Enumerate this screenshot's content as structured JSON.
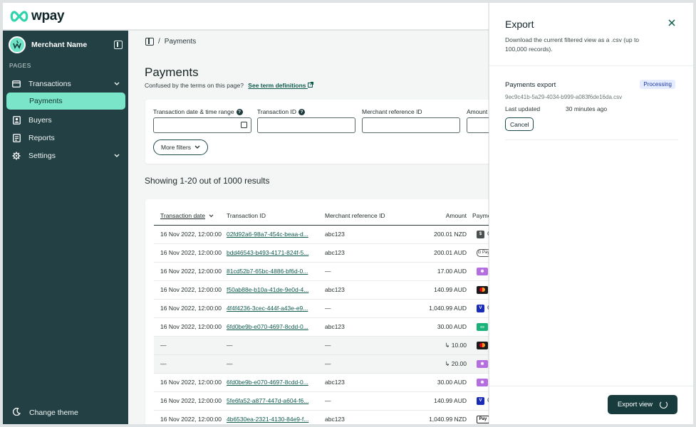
{
  "brand": {
    "name": "wpay"
  },
  "sidebar": {
    "merchant_name": "Merchant Name",
    "section_label": "PAGES",
    "items": [
      {
        "label": "Transactions",
        "icon": "card-icon",
        "has_chevron": true
      },
      {
        "label": "Payments",
        "active": true
      },
      {
        "label": "Buyers",
        "icon": "user-icon"
      },
      {
        "label": "Reports",
        "icon": "report-icon"
      },
      {
        "label": "Settings",
        "icon": "gear-icon",
        "has_chevron": true
      }
    ],
    "theme_label": "Change theme"
  },
  "breadcrumb": {
    "separator": "/",
    "current": "Payments"
  },
  "page": {
    "title": "Payments",
    "subtitle": "Confused by the terms on this page?",
    "subtitle_link": "See term definitions"
  },
  "filters": {
    "date_label": "Transaction date & time range",
    "txid_label": "Transaction ID",
    "merchant_ref_label": "Merchant reference ID",
    "amount_label": "Amount",
    "more_filters": "More filters"
  },
  "results_text": "Showing 1-20 out of 1000 results",
  "table": {
    "headers": [
      "Transaction date",
      "Transaction ID",
      "Merchant reference ID",
      "Amount",
      "Paymer"
    ],
    "rows": [
      {
        "date": "16 Nov 2022, 12:00:00",
        "id": "02fd92a6-98a7-454c-beaa-d...",
        "ref": "abc123",
        "amount": "200.01 NZD",
        "pm": "dollar",
        "pm_text": "C"
      },
      {
        "date": "16 Nov 2022, 12:00:00",
        "id": "bdd46543-b493-4171-824f-5...",
        "ref": "abc123",
        "amount": "200.01 AUD",
        "pm": "gpay",
        "pm_text": "C"
      },
      {
        "date": "16 Nov 2022, 12:00:00",
        "id": "81cd52b7-65bc-4886-bf6d-0...",
        "ref": "—",
        "amount": "17.00 AUD",
        "pm": "star",
        "pm_text": "C"
      },
      {
        "date": "16 Nov 2022, 12:00:00",
        "id": "f50ab88e-b10a-41de-9e0d-4...",
        "ref": "abc123",
        "amount": "140.99 AUD",
        "pm": "mc",
        "pm_text": "C"
      },
      {
        "date": "16 Nov 2022, 12:00:00",
        "id": "4f4f4236-3cec-444f-a43e-e9...",
        "ref": "—",
        "amount": "1,040.99 AUD",
        "pm": "visa",
        "pm_text": "C"
      },
      {
        "date": "16 Nov 2022, 12:00:00",
        "id": "6fd0be9b-e070-4697-8cdd-0...",
        "ref": "abc123",
        "amount": "30.00 AUD",
        "pm": "card",
        "pm_text": "M"
      },
      {
        "date": "—",
        "id": "—",
        "ref": "—",
        "amount": "↳ 10.00",
        "pm": "mc",
        "pm_text": "C",
        "gray": true
      },
      {
        "date": "—",
        "id": "—",
        "ref": "—",
        "amount": "↳ 20.00",
        "pm": "star",
        "pm_text": "C",
        "gray": true
      },
      {
        "date": "16 Nov 2022, 12:00:00",
        "id": "6fd0be9b-e070-4697-8cdd-0...",
        "ref": "abc123",
        "amount": "30.00 AUD",
        "pm": "star",
        "pm_text": "M"
      },
      {
        "date": "16 Nov 2022, 12:00:00",
        "id": "5fe6fa52-a877-447d-a604-f6...",
        "ref": "—",
        "amount": "140.99 AUD",
        "pm": "visa",
        "pm_text": "C"
      },
      {
        "date": "16 Nov 2022, 12:00:00",
        "id": "4b6530ea-2321-4130-84e9-f...",
        "ref": "abc123",
        "amount": "1,040.99 NZD",
        "pm": "apay",
        "pm_text": "C"
      }
    ]
  },
  "export_panel": {
    "title": "Export",
    "description": "Download the current filtered view as a .csv (up to 100,000 records).",
    "export_title": "Payments export",
    "status": "Processing",
    "export_id": "9ec9c41b-5a29-4034-b999-a083f6de16da.csv",
    "updated_label": "Last updated",
    "updated_value": "30 minutes ago",
    "cancel_label": "Cancel",
    "export_button": "Export view"
  },
  "colors": {
    "sidebar_bg": "#234044",
    "accent": "#7ae5c8",
    "link": "#0d5a4d",
    "primary_button": "#183c3d",
    "badge_bg": "#e6ecff"
  }
}
